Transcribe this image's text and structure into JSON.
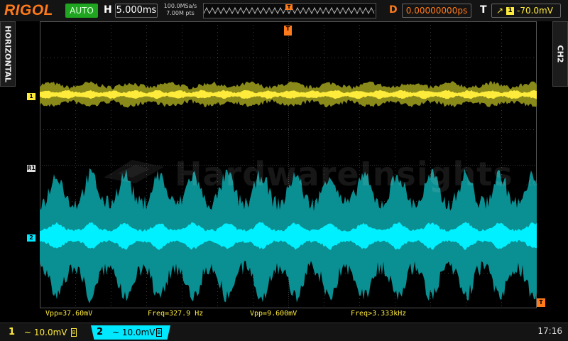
{
  "header": {
    "brand": "RIGOL",
    "run_mode": "AUTO",
    "h_label": "H",
    "timebase": "5.000ms",
    "sample_rate": "100.0MSa/s",
    "memory_depth": "7.00M pts",
    "d_label": "D",
    "trigger_delay": "0.00000000ps",
    "t_label": "T",
    "trigger_source": "1",
    "trigger_level": "-70.0mV",
    "trigger_edge_icon": "rising-edge-icon"
  },
  "side_tabs": {
    "left": "HORIZONTAL",
    "right": "CH2"
  },
  "markers": {
    "ch1": "1",
    "ch2": "2",
    "ref": "R1",
    "trigger_position": "T",
    "trigger_level": "T"
  },
  "watermark": {
    "text": "HardwareInsights",
    "suffix": ".com"
  },
  "measurements": [
    {
      "text": "Vpp=37.60mV",
      "color": "#ffeb3b"
    },
    {
      "text": "Freq=327.9 Hz",
      "color": "#ffeb3b"
    },
    {
      "text": "Vpp=9.600mV",
      "color": "#ffeb3b"
    },
    {
      "text": "Freq>3.333kHz",
      "color": "#ffeb3b"
    }
  ],
  "channels": [
    {
      "number": "1",
      "value": "~ 10.0mV",
      "color": "#ffeb3b",
      "bw_icon": "B"
    },
    {
      "number": "2",
      "value": "~ 10.0mV",
      "color": "#00e8ff",
      "bw_icon": "B"
    }
  ],
  "clock": "17:16",
  "colors": {
    "ch1": "#ffeb3b",
    "ch1_envelope": "#8a8a1a",
    "ch2": "#00f0ff",
    "ch2_envelope": "#0a8f92",
    "trigger": "#ff7a1a",
    "grid": "#3a3a3a"
  }
}
